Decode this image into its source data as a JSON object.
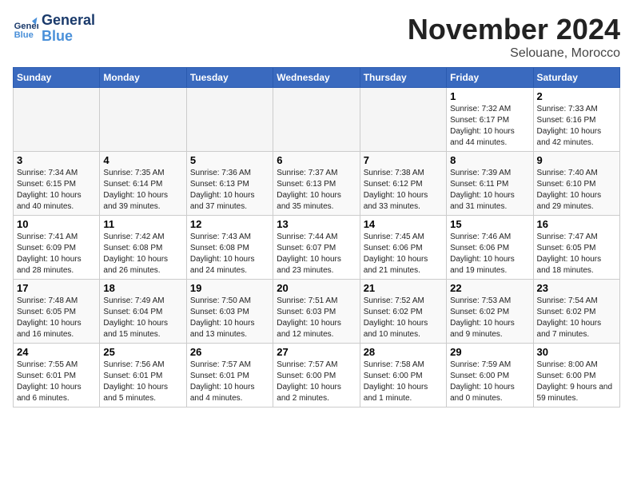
{
  "logo": {
    "line1": "General",
    "line2": "Blue"
  },
  "header": {
    "month": "November 2024",
    "location": "Selouane, Morocco"
  },
  "weekdays": [
    "Sunday",
    "Monday",
    "Tuesday",
    "Wednesday",
    "Thursday",
    "Friday",
    "Saturday"
  ],
  "weeks": [
    [
      {
        "day": "",
        "empty": true
      },
      {
        "day": "",
        "empty": true
      },
      {
        "day": "",
        "empty": true
      },
      {
        "day": "",
        "empty": true
      },
      {
        "day": "",
        "empty": true
      },
      {
        "day": "1",
        "sunrise": "Sunrise: 7:32 AM",
        "sunset": "Sunset: 6:17 PM",
        "daylight": "Daylight: 10 hours and 44 minutes."
      },
      {
        "day": "2",
        "sunrise": "Sunrise: 7:33 AM",
        "sunset": "Sunset: 6:16 PM",
        "daylight": "Daylight: 10 hours and 42 minutes."
      }
    ],
    [
      {
        "day": "3",
        "sunrise": "Sunrise: 7:34 AM",
        "sunset": "Sunset: 6:15 PM",
        "daylight": "Daylight: 10 hours and 40 minutes."
      },
      {
        "day": "4",
        "sunrise": "Sunrise: 7:35 AM",
        "sunset": "Sunset: 6:14 PM",
        "daylight": "Daylight: 10 hours and 39 minutes."
      },
      {
        "day": "5",
        "sunrise": "Sunrise: 7:36 AM",
        "sunset": "Sunset: 6:13 PM",
        "daylight": "Daylight: 10 hours and 37 minutes."
      },
      {
        "day": "6",
        "sunrise": "Sunrise: 7:37 AM",
        "sunset": "Sunset: 6:13 PM",
        "daylight": "Daylight: 10 hours and 35 minutes."
      },
      {
        "day": "7",
        "sunrise": "Sunrise: 7:38 AM",
        "sunset": "Sunset: 6:12 PM",
        "daylight": "Daylight: 10 hours and 33 minutes."
      },
      {
        "day": "8",
        "sunrise": "Sunrise: 7:39 AM",
        "sunset": "Sunset: 6:11 PM",
        "daylight": "Daylight: 10 hours and 31 minutes."
      },
      {
        "day": "9",
        "sunrise": "Sunrise: 7:40 AM",
        "sunset": "Sunset: 6:10 PM",
        "daylight": "Daylight: 10 hours and 29 minutes."
      }
    ],
    [
      {
        "day": "10",
        "sunrise": "Sunrise: 7:41 AM",
        "sunset": "Sunset: 6:09 PM",
        "daylight": "Daylight: 10 hours and 28 minutes."
      },
      {
        "day": "11",
        "sunrise": "Sunrise: 7:42 AM",
        "sunset": "Sunset: 6:08 PM",
        "daylight": "Daylight: 10 hours and 26 minutes."
      },
      {
        "day": "12",
        "sunrise": "Sunrise: 7:43 AM",
        "sunset": "Sunset: 6:08 PM",
        "daylight": "Daylight: 10 hours and 24 minutes."
      },
      {
        "day": "13",
        "sunrise": "Sunrise: 7:44 AM",
        "sunset": "Sunset: 6:07 PM",
        "daylight": "Daylight: 10 hours and 23 minutes."
      },
      {
        "day": "14",
        "sunrise": "Sunrise: 7:45 AM",
        "sunset": "Sunset: 6:06 PM",
        "daylight": "Daylight: 10 hours and 21 minutes."
      },
      {
        "day": "15",
        "sunrise": "Sunrise: 7:46 AM",
        "sunset": "Sunset: 6:06 PM",
        "daylight": "Daylight: 10 hours and 19 minutes."
      },
      {
        "day": "16",
        "sunrise": "Sunrise: 7:47 AM",
        "sunset": "Sunset: 6:05 PM",
        "daylight": "Daylight: 10 hours and 18 minutes."
      }
    ],
    [
      {
        "day": "17",
        "sunrise": "Sunrise: 7:48 AM",
        "sunset": "Sunset: 6:05 PM",
        "daylight": "Daylight: 10 hours and 16 minutes."
      },
      {
        "day": "18",
        "sunrise": "Sunrise: 7:49 AM",
        "sunset": "Sunset: 6:04 PM",
        "daylight": "Daylight: 10 hours and 15 minutes."
      },
      {
        "day": "19",
        "sunrise": "Sunrise: 7:50 AM",
        "sunset": "Sunset: 6:03 PM",
        "daylight": "Daylight: 10 hours and 13 minutes."
      },
      {
        "day": "20",
        "sunrise": "Sunrise: 7:51 AM",
        "sunset": "Sunset: 6:03 PM",
        "daylight": "Daylight: 10 hours and 12 minutes."
      },
      {
        "day": "21",
        "sunrise": "Sunrise: 7:52 AM",
        "sunset": "Sunset: 6:02 PM",
        "daylight": "Daylight: 10 hours and 10 minutes."
      },
      {
        "day": "22",
        "sunrise": "Sunrise: 7:53 AM",
        "sunset": "Sunset: 6:02 PM",
        "daylight": "Daylight: 10 hours and 9 minutes."
      },
      {
        "day": "23",
        "sunrise": "Sunrise: 7:54 AM",
        "sunset": "Sunset: 6:02 PM",
        "daylight": "Daylight: 10 hours and 7 minutes."
      }
    ],
    [
      {
        "day": "24",
        "sunrise": "Sunrise: 7:55 AM",
        "sunset": "Sunset: 6:01 PM",
        "daylight": "Daylight: 10 hours and 6 minutes."
      },
      {
        "day": "25",
        "sunrise": "Sunrise: 7:56 AM",
        "sunset": "Sunset: 6:01 PM",
        "daylight": "Daylight: 10 hours and 5 minutes."
      },
      {
        "day": "26",
        "sunrise": "Sunrise: 7:57 AM",
        "sunset": "Sunset: 6:01 PM",
        "daylight": "Daylight: 10 hours and 4 minutes."
      },
      {
        "day": "27",
        "sunrise": "Sunrise: 7:57 AM",
        "sunset": "Sunset: 6:00 PM",
        "daylight": "Daylight: 10 hours and 2 minutes."
      },
      {
        "day": "28",
        "sunrise": "Sunrise: 7:58 AM",
        "sunset": "Sunset: 6:00 PM",
        "daylight": "Daylight: 10 hours and 1 minute."
      },
      {
        "day": "29",
        "sunrise": "Sunrise: 7:59 AM",
        "sunset": "Sunset: 6:00 PM",
        "daylight": "Daylight: 10 hours and 0 minutes."
      },
      {
        "day": "30",
        "sunrise": "Sunrise: 8:00 AM",
        "sunset": "Sunset: 6:00 PM",
        "daylight": "Daylight: 9 hours and 59 minutes."
      }
    ]
  ]
}
